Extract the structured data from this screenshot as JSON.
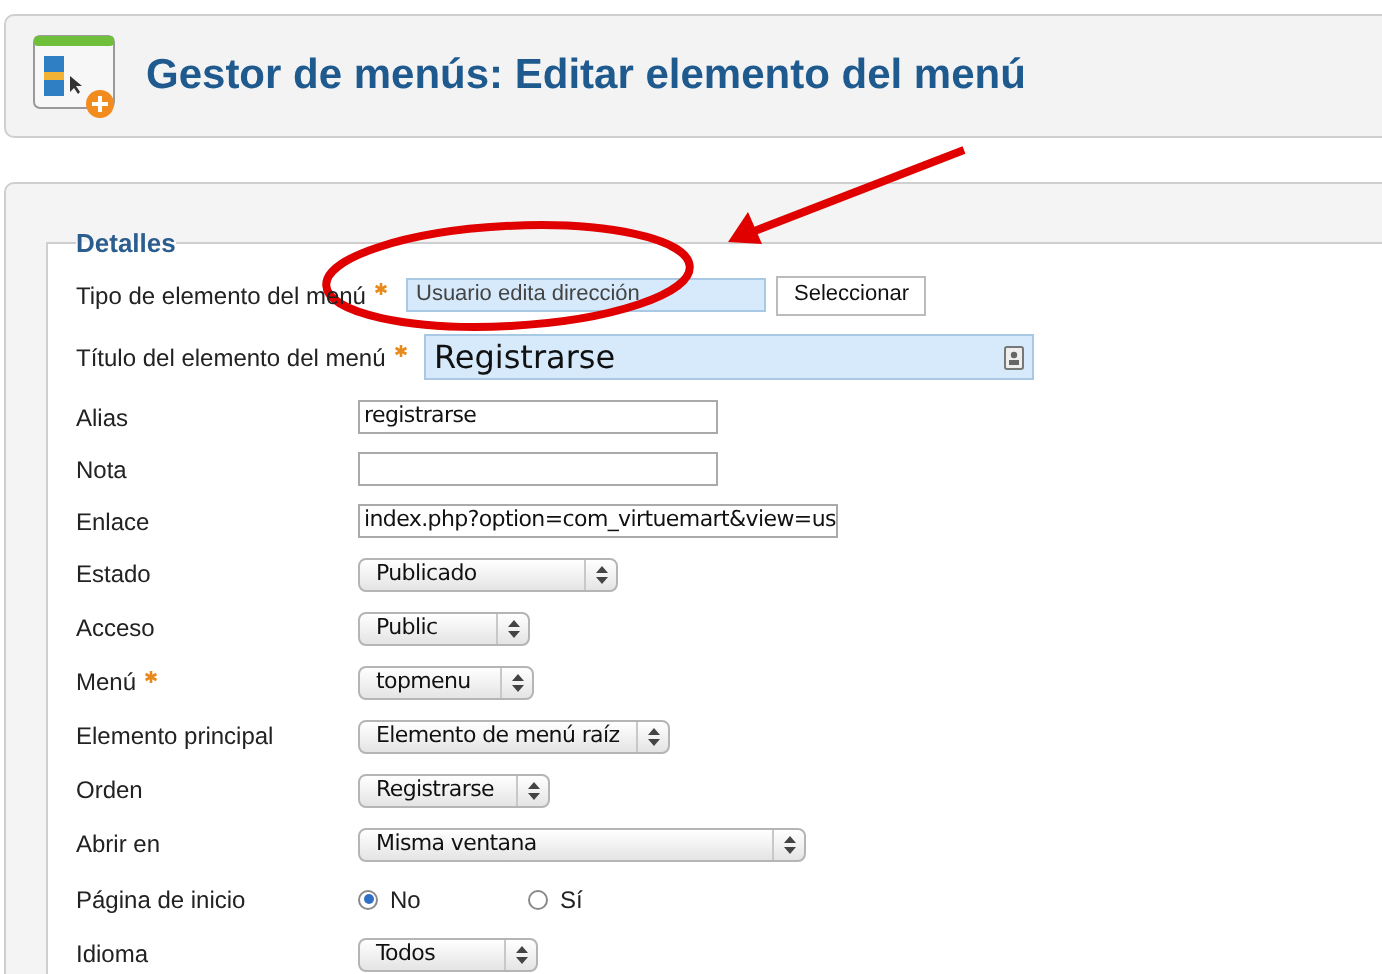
{
  "header": {
    "title": "Gestor de menús: Editar elemento del menú"
  },
  "fieldset": {
    "legend": "Detalles"
  },
  "fields": [
    {
      "kind": "picker",
      "label": "Tipo de elemento del menú",
      "required": true,
      "value": "Usuario edita dirección",
      "button": "Seleccionar"
    },
    {
      "kind": "title",
      "label": "Título del elemento del menú",
      "required": true,
      "value": "Registrarse"
    },
    {
      "kind": "text",
      "label": "Alias",
      "required": false,
      "value": "registrarse"
    },
    {
      "kind": "text",
      "label": "Nota",
      "required": false
    },
    {
      "kind": "text",
      "label": "Enlace",
      "required": false,
      "value": "index.php?option=com_virtuemart&view=us"
    },
    {
      "kind": "select",
      "label": "Estado",
      "required": false,
      "value": "Publicado"
    },
    {
      "kind": "select",
      "label": "Acceso",
      "required": false,
      "value": "Public"
    },
    {
      "kind": "select",
      "label": "Menú",
      "required": true,
      "value": "topmenu"
    },
    {
      "kind": "select",
      "label": "Elemento principal",
      "required": false,
      "value": "Elemento de menú raíz"
    },
    {
      "kind": "select",
      "label": "Orden",
      "required": false,
      "value": "Registrarse"
    },
    {
      "kind": "select",
      "label": "Abrir en",
      "required": false,
      "value": "Misma ventana"
    },
    {
      "kind": "radio",
      "label": "Página de inicio",
      "required": false,
      "options": [
        {
          "label": "No",
          "selected": true
        },
        {
          "label": "Sí",
          "selected": false
        }
      ]
    },
    {
      "kind": "select",
      "label": "Idioma",
      "required": false,
      "value": "Todos"
    }
  ]
}
